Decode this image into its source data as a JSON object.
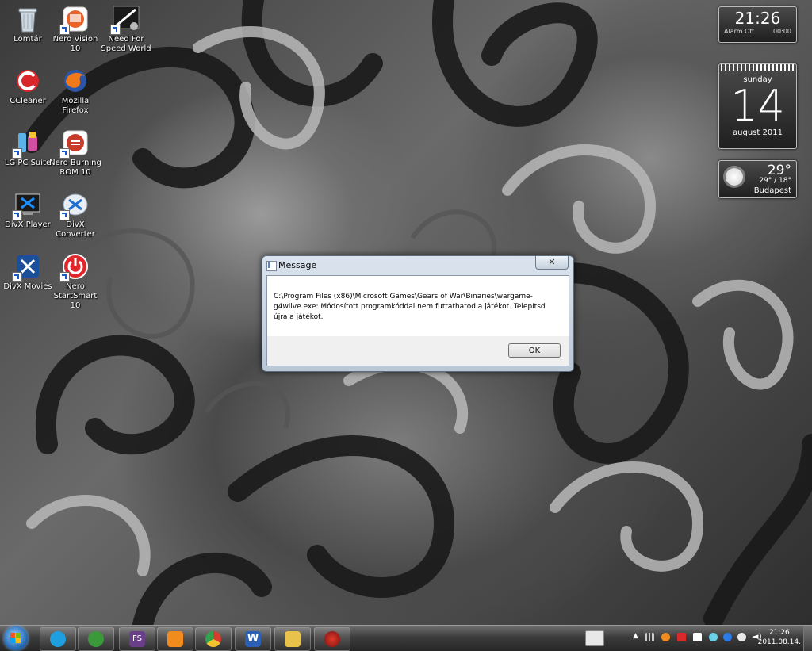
{
  "desktop_icons": [
    {
      "label": "Lomtár",
      "icon": "recycle-bin-icon"
    },
    {
      "label": "Nero Vision 10",
      "icon": "nero-vision-icon"
    },
    {
      "label": "Need For Speed World",
      "icon": "nfs-world-icon"
    },
    {
      "label": "CCleaner",
      "icon": "ccleaner-icon"
    },
    {
      "label": "Mozilla Firefox",
      "icon": "firefox-icon"
    },
    {
      "label": "LG PC Suite",
      "icon": "lg-pc-suite-icon"
    },
    {
      "label": "Nero Burning ROM 10",
      "icon": "nero-burning-rom-icon"
    },
    {
      "label": "DivX Player",
      "icon": "divx-player-icon"
    },
    {
      "label": "DivX Converter",
      "icon": "divx-converter-icon"
    },
    {
      "label": "DivX Movies",
      "icon": "divx-movies-icon"
    },
    {
      "label": "Nero StartSmart 10",
      "icon": "nero-startsmart-icon"
    }
  ],
  "gadgets": {
    "clock": {
      "time": "21:26",
      "alarm_label": "Alarm Off",
      "alarm_time": "00:00"
    },
    "calendar": {
      "weekday": "sunday",
      "day": "14",
      "month_year": "august 2011"
    },
    "weather": {
      "temp": "29°",
      "range": "29° / 18°",
      "city": "Budapest",
      "icon": "sun-icon"
    }
  },
  "dialog": {
    "title": "Message",
    "close_label": "✕",
    "message": "C:\\Program Files (x86)\\Microsoft Games\\Gears of War\\Binaries\\wargame-g4wlive.exe: Módosított programkóddal nem futtathatod a játékot. Telepítsd újra a játékot.",
    "ok_label": "OK"
  },
  "taskbar": {
    "pinned": [
      {
        "name": "skype",
        "icon": "skype-icon",
        "color": "#1ea0e0"
      },
      {
        "name": "messenger",
        "icon": "messenger-icon",
        "color": "#3a9a3a"
      },
      {
        "name": "fraps",
        "label": "FS",
        "icon": "fs-icon",
        "color": "#6a3f8a"
      },
      {
        "name": "media-player",
        "icon": "media-player-icon",
        "color": "#f08c1e"
      },
      {
        "name": "chrome",
        "icon": "chrome-icon",
        "color": "#d83c2c"
      },
      {
        "name": "word",
        "label": "W",
        "icon": "word-icon",
        "color": "#2a5fb5"
      },
      {
        "name": "explorer",
        "icon": "folder-icon",
        "color": "#e8c34a"
      },
      {
        "name": "gears-of-war",
        "icon": "gears-of-war-icon",
        "color": "#a8201a"
      }
    ],
    "tray_icons": [
      "show-hidden-icons",
      "network-icon",
      "orange-app-icon",
      "red-app-icon",
      "flag-icon",
      "update-icon",
      "blue-app-icon",
      "power-icon",
      "volume-icon"
    ],
    "clock": {
      "time": "21:26",
      "date": "2011.08.14."
    }
  }
}
